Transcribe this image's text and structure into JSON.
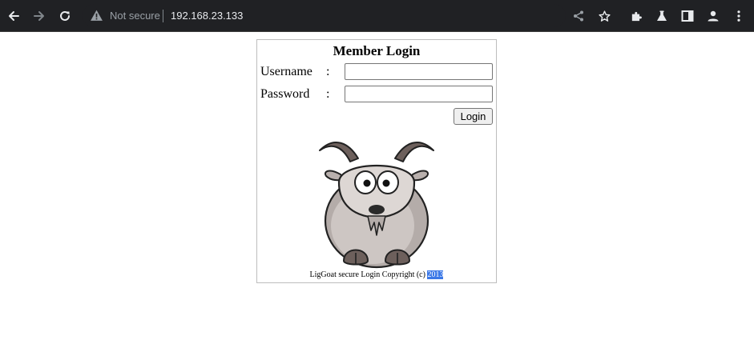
{
  "browser": {
    "security_label": "Not secure",
    "url": "192.168.23.133",
    "icons": {
      "back": "arrow-left-icon",
      "forward": "arrow-right-icon",
      "reload": "reload-icon",
      "security": "warning-triangle-icon",
      "share": "share-icon",
      "bookmark": "star-icon",
      "extensions": "puzzle-icon",
      "labs": "flask-icon",
      "side_panel": "side-panel-icon",
      "profile": "person-icon",
      "menu": "kebab-menu-icon"
    },
    "colors": {
      "toolbar_bg": "#202124",
      "icon": "#e8eaed",
      "icon_disabled": "#80868b",
      "security_text": "#9aa0a6"
    }
  },
  "login": {
    "title": "Member Login",
    "username_label": "Username",
    "password_label": "Password",
    "separator": ":",
    "username_value": "",
    "password_value": "",
    "submit_label": "Login",
    "footer_text": "LigGoat secure Login Copyright (c) ",
    "footer_year": "2013"
  },
  "colors": {
    "selection_highlight": "#3b78e7",
    "panel_border": "#bdbdbd"
  }
}
